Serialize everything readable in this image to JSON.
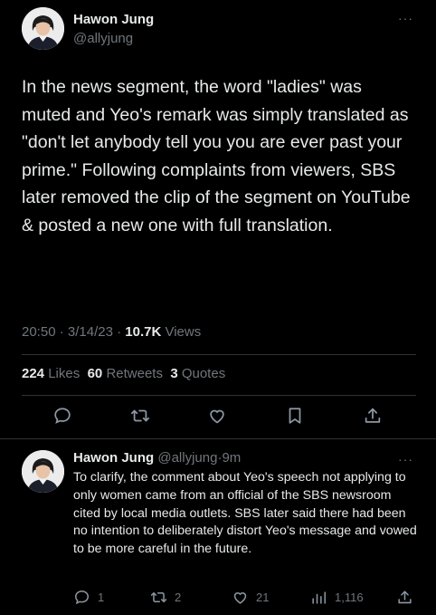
{
  "main_tweet": {
    "author_name": "Hawon Jung",
    "author_handle": "@allyjung",
    "more_label": "···",
    "text": "In the news segment, the word \"ladies\" was muted and Yeo's remark was simply translated as \"don't let anybody tell you you are ever past your prime.\" Following complaints from viewers, SBS later removed the clip of the segment on YouTube & posted a new one with full translation.",
    "time": "20:50",
    "date": "3/14/23",
    "views_count": "10.7K",
    "views_label": "Views",
    "likes_count": "224",
    "likes_label": "Likes",
    "retweets_count": "60",
    "retweets_label": "Retweets",
    "quotes_count": "3",
    "quotes_label": "Quotes",
    "actions": [
      "reply-icon",
      "retweet-icon",
      "like-icon",
      "bookmark-icon",
      "share-icon"
    ]
  },
  "reply": {
    "author_name": "Hawon Jung",
    "author_handle": "@allyjung",
    "time_ago": "9m",
    "separator": "·",
    "more_label": "···",
    "text": "To clarify, the comment about Yeo's speech not applying to only women came from an official of the SBS newsroom cited by local media outlets. SBS later said there had been no intention to deliberately distort Yeo's message and vowed to be more careful in the future.",
    "reply_count": "1",
    "retweet_count": "2",
    "like_count": "21",
    "view_count": "1,116"
  },
  "colors": {
    "background": "#000000",
    "text": "#e7e9ea",
    "muted": "#71767b",
    "divider": "#2f3336"
  }
}
